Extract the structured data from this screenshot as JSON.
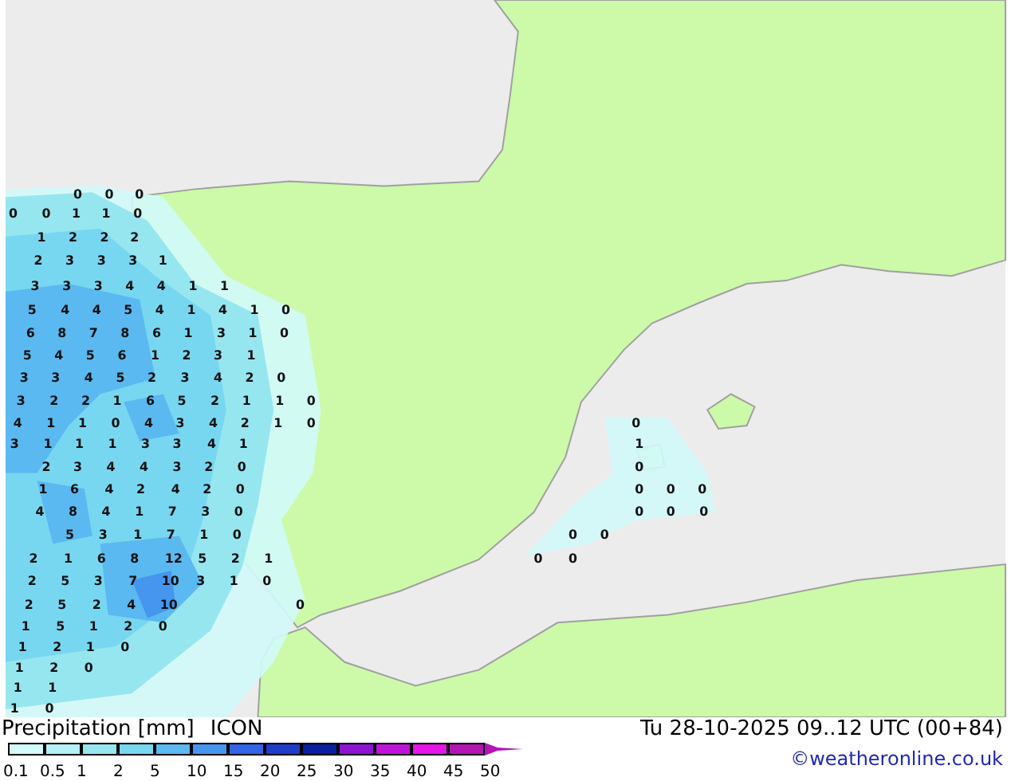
{
  "map": {
    "values": [
      "0",
      "0",
      "0",
      "0",
      "0",
      "1",
      "1",
      "0",
      "1",
      "2",
      "2",
      "2",
      "2",
      "3",
      "3",
      "3",
      "1",
      "3",
      "3",
      "3",
      "4",
      "4",
      "1",
      "1",
      "5",
      "4",
      "4",
      "5",
      "4",
      "1",
      "4",
      "1",
      "0",
      "6",
      "8",
      "7",
      "8",
      "6",
      "1",
      "3",
      "1",
      "0",
      "5",
      "4",
      "5",
      "6",
      "1",
      "2",
      "3",
      "1",
      "3",
      "3",
      "4",
      "5",
      "2",
      "3",
      "4",
      "2",
      "0",
      "3",
      "2",
      "2",
      "1",
      "6",
      "5",
      "2",
      "1",
      "1",
      "0",
      "4",
      "1",
      "1",
      "0",
      "4",
      "3",
      "4",
      "2",
      "1",
      "0",
      "0",
      "3",
      "1",
      "1",
      "1",
      "3",
      "3",
      "4",
      "1",
      "1",
      "2",
      "3",
      "4",
      "4",
      "3",
      "2",
      "0",
      "0",
      "1",
      "6",
      "4",
      "2",
      "4",
      "2",
      "0",
      "0",
      "0",
      "0",
      "4",
      "8",
      "4",
      "1",
      "7",
      "3",
      "0",
      "0",
      "0",
      "0",
      "5",
      "3",
      "1",
      "7",
      "1",
      "0",
      "0",
      "0",
      "2",
      "1",
      "6",
      "8",
      "12",
      "5",
      "2",
      "1",
      "0",
      "0",
      "2",
      "5",
      "3",
      "7",
      "10",
      "3",
      "1",
      "0",
      "2",
      "5",
      "2",
      "4",
      "10",
      "0",
      "1",
      "5",
      "1",
      "2",
      "0",
      "1",
      "2",
      "1",
      "0",
      "1",
      "2",
      "0",
      "1",
      "1",
      "1",
      "0"
    ]
  },
  "legend": {
    "title": "Precipitation [mm]",
    "model": "ICON",
    "scale": [
      {
        "color": "#d2fafa"
      },
      {
        "color": "#b4f0f5"
      },
      {
        "color": "#96e6f0"
      },
      {
        "color": "#78d7f0"
      },
      {
        "color": "#5ab9f0"
      },
      {
        "color": "#4696f0"
      },
      {
        "color": "#3264e6"
      },
      {
        "color": "#1e3cc8"
      },
      {
        "color": "#0a1ea0"
      },
      {
        "color": "#8c14d2"
      },
      {
        "color": "#be14d7"
      },
      {
        "color": "#e614e6"
      },
      {
        "color": "#b414b4"
      }
    ],
    "labels": [
      "0.1",
      "0.5",
      "1",
      "2",
      "5",
      "10",
      "15",
      "20",
      "25",
      "30",
      "35",
      "40",
      "45",
      "50"
    ]
  },
  "valid_time": "Tu 28-10-2025 09..12 UTC (00+84)",
  "credit": "©weatheronline.co.uk"
}
